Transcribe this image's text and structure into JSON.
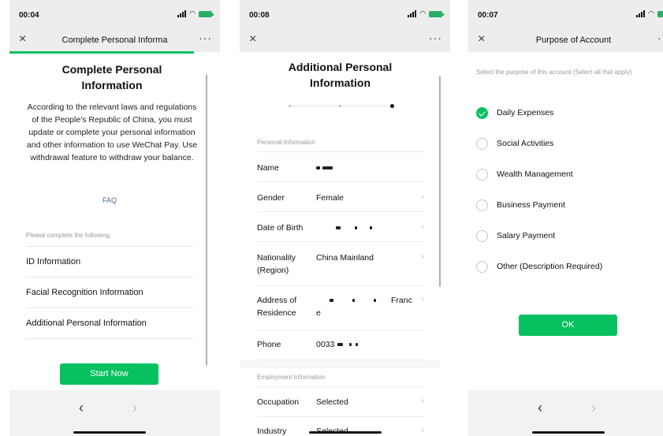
{
  "panel1": {
    "status": {
      "time": "00:04"
    },
    "nav": {
      "title": "Complete Personal Informa",
      "close": "×",
      "more": "···"
    },
    "title_line1": "Complete Personal",
    "title_line2": "Information",
    "description": "According to the relevant laws and regulations of the People's Republic of China, you must update or complete your personal information and other information to use WeChat Pay. Use withdrawal feature to withdraw your balance.",
    "faq": "FAQ",
    "section_label": "Please complete the following:",
    "items": [
      {
        "label": "ID Information"
      },
      {
        "label": "Facial Recognition Information"
      },
      {
        "label": "Additional Personal Information"
      }
    ],
    "start_button": "Start Now",
    "bottom_nav": {
      "back": "‹",
      "forward": "›"
    }
  },
  "panel2": {
    "status": {
      "time": "00:08"
    },
    "nav": {
      "close": "×",
      "more": "···"
    },
    "title_line1": "Additional Personal",
    "title_line2": "Information",
    "steps": {
      "total": 3,
      "current": 3
    },
    "personal_section": "Personal Information",
    "fields": {
      "name": {
        "label": "Name"
      },
      "gender": {
        "label": "Gender",
        "value": "Female"
      },
      "dob": {
        "label": "Date of Birth"
      },
      "nationality": {
        "label_line1": "Nationality",
        "label_line2": "(Region)",
        "value": "China Mainland"
      },
      "address": {
        "label_line1": "Address of",
        "label_line2": "Residence",
        "value_end": "Franc",
        "value_wrap": "e"
      },
      "phone": {
        "label": "Phone",
        "value_prefix": "0033"
      }
    },
    "employment_section": "Employment Information",
    "occupation": {
      "label": "Occupation",
      "value": "Selected"
    },
    "industry": {
      "label": "Industry",
      "value": "Selected"
    },
    "chevron": "›"
  },
  "panel3": {
    "status": {
      "time": "00:07"
    },
    "nav": {
      "title": "Purpose of Account",
      "close": "×",
      "more": "···"
    },
    "hint": "Select the purpose of this account (Select all that apply)",
    "options": [
      {
        "label": "Daily Expenses",
        "checked": true
      },
      {
        "label": "Social Activities",
        "checked": false
      },
      {
        "label": "Wealth Management",
        "checked": false
      },
      {
        "label": "Business Payment",
        "checked": false
      },
      {
        "label": "Salary Payment",
        "checked": false
      },
      {
        "label": "Other (Description Required)",
        "checked": false
      }
    ],
    "ok_button": "OK",
    "bottom_nav": {
      "back": "‹",
      "forward": "›"
    }
  },
  "colors": {
    "accent": "#07c160",
    "link": "#4a6b96",
    "muted": "#999999"
  },
  "icons": [
    "close-icon",
    "more-icon",
    "signal-icon",
    "wifi-icon",
    "battery-icon",
    "chevron-right-icon",
    "check-icon",
    "back-icon",
    "forward-icon"
  ]
}
